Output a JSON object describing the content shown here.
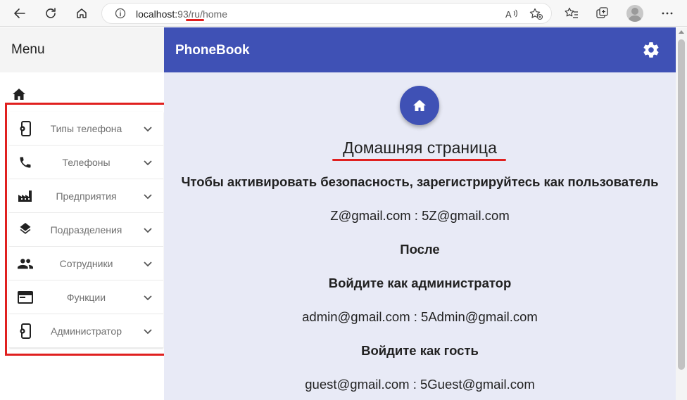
{
  "browser": {
    "url_host": "localhost:",
    "url_port_path": "93/ru/home",
    "read_aloud_label": "Â"
  },
  "sidebar": {
    "title": "Menu",
    "items": [
      {
        "label": "Типы телефона",
        "icon": "phone-settings-icon"
      },
      {
        "label": "Телефоны",
        "icon": "phone-icon"
      },
      {
        "label": "Предприятия",
        "icon": "factory-icon"
      },
      {
        "label": "Подразделения",
        "icon": "layers-icon"
      },
      {
        "label": "Сотрудники",
        "icon": "people-icon"
      },
      {
        "label": "Функции",
        "icon": "function-card-icon"
      },
      {
        "label": "Администратор",
        "icon": "phone-settings-icon"
      }
    ]
  },
  "appbar": {
    "title": "PhoneBook"
  },
  "main": {
    "heading": "Домашняя страница",
    "lines": [
      "Чтобы активировать безопасность, зарегистрируйтесь как пользователь",
      "Z@gmail.com : 5Z@gmail.com",
      "После",
      "Войдите как администратор",
      "admin@gmail.com : 5Admin@gmail.com",
      "Войдите как гость",
      "guest@gmail.com : 5Guest@gmail.com"
    ]
  },
  "colors": {
    "primary": "#3f51b5",
    "content_bg": "#e8eaf6",
    "highlight_red": "#e0201f"
  }
}
